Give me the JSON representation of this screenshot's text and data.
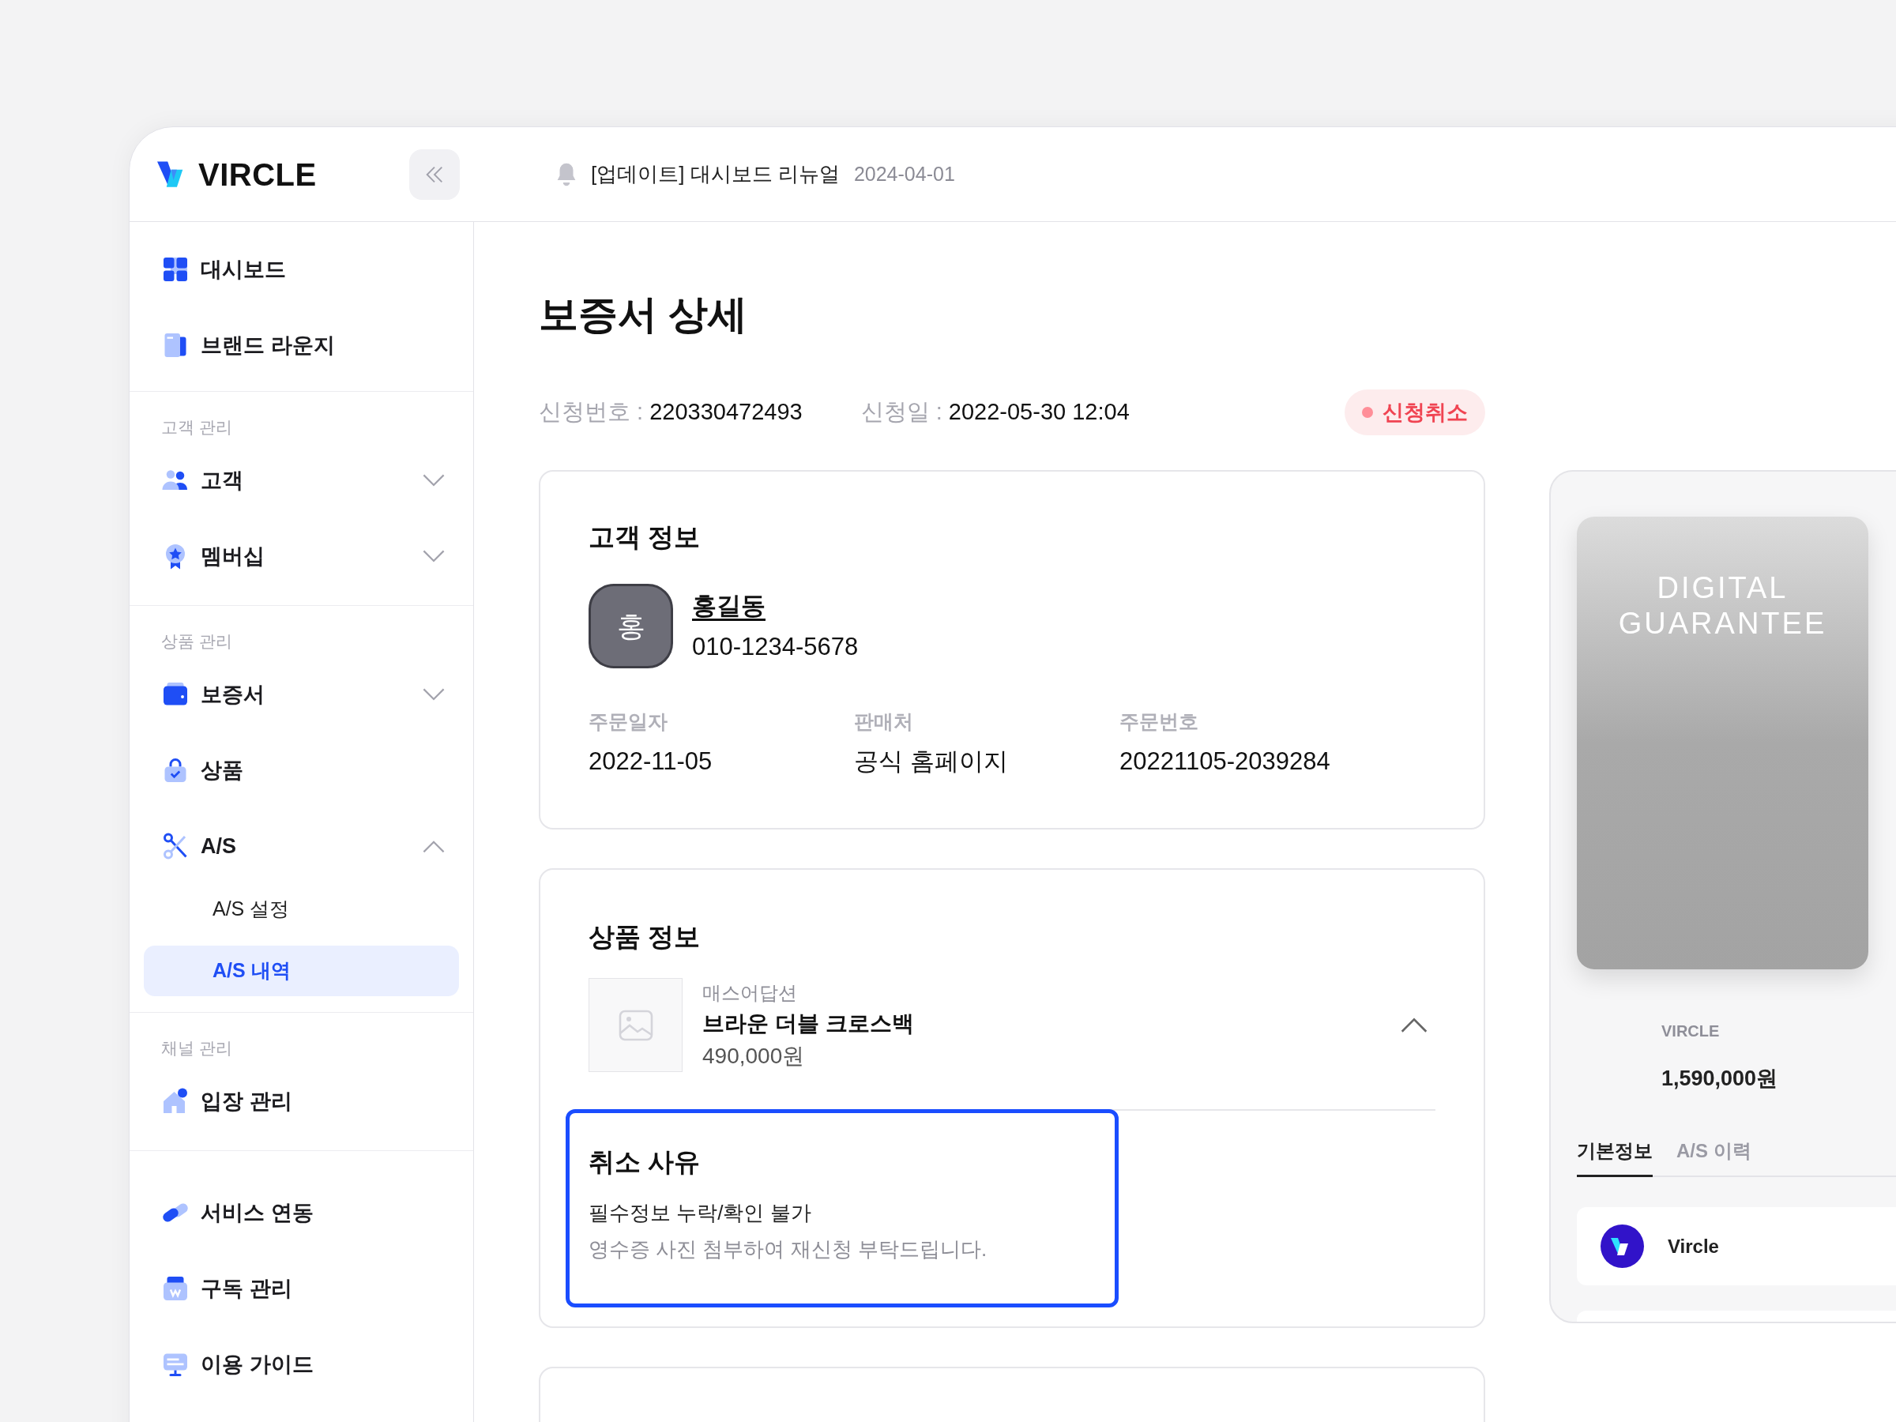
{
  "sidebar": {
    "logo": "VIRCLE",
    "groups": [
      {
        "items": [
          {
            "label": "대시보드"
          },
          {
            "label": "브랜드 라운지"
          }
        ]
      },
      {
        "heading": "고객 관리",
        "items": [
          {
            "label": "고객",
            "expanded": false
          },
          {
            "label": "멤버십",
            "expanded": false
          }
        ]
      },
      {
        "heading": "상품 관리",
        "items": [
          {
            "label": "보증서",
            "expanded": false
          },
          {
            "label": "상품"
          },
          {
            "label": "A/S",
            "expanded": true,
            "children": [
              {
                "label": "A/S 설정",
                "selected": false
              },
              {
                "label": "A/S 내역",
                "selected": true
              }
            ]
          }
        ]
      },
      {
        "heading": "채널 관리",
        "items": [
          {
            "label": "입장 관리"
          }
        ]
      },
      {
        "items": [
          {
            "label": "서비스 연동"
          },
          {
            "label": "구독 관리"
          },
          {
            "label": "이용 가이드"
          }
        ]
      }
    ]
  },
  "header": {
    "notice": "[업데이트] 대시보드 리뉴얼",
    "date": "2024-04-01"
  },
  "page": {
    "title": "보증서 상세",
    "meta": [
      {
        "label": "신청번호 :",
        "value": "220330472493"
      },
      {
        "label": "신청일 :",
        "value": "2022-05-30 12:04"
      }
    ],
    "status": "신청취소"
  },
  "customer": {
    "title": "고객 정보",
    "avatar": "홍",
    "name": "홍길동",
    "phone": "010-1234-5678",
    "fields": [
      {
        "label": "주문일자",
        "value": "2022-11-05"
      },
      {
        "label": "판매처",
        "value": "공식 홈페이지"
      },
      {
        "label": "주문번호",
        "value": "20221105-2039284"
      }
    ]
  },
  "product": {
    "title": "상품 정보",
    "brand": "매스어답션",
    "name": "브라운 더블 크로스백",
    "price": "490,000원",
    "expanded": true,
    "cancel_reason": {
      "title": "취소 사유",
      "reason": "필수정보 누락/확인 불가",
      "note": "영수증 사진 첨부하여 재신청 부탁드립니다."
    }
  },
  "guarantee": {
    "card_title": "DIGITAL GUARANTEE",
    "brand": "VIRCLE",
    "price": "1,590,000원",
    "tabs": [
      {
        "label": "기본정보",
        "selected": true
      },
      {
        "label": "A/S 이력",
        "selected": false
      }
    ],
    "partner": "Vircle"
  }
}
